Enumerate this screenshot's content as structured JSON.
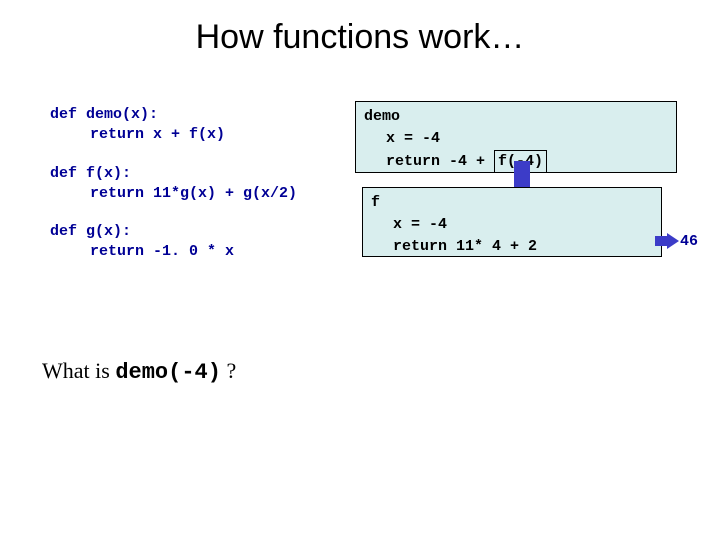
{
  "title": "How functions work…",
  "code": {
    "demo": {
      "def": "def demo(x):",
      "ret": "return x + f(x)"
    },
    "f": {
      "def": "def f(x):",
      "ret": "return 11*g(x) + g(x/2)"
    },
    "g": {
      "def": "def g(x):",
      "ret": "return -1. 0 * x"
    }
  },
  "trace": {
    "demo": {
      "name": "demo",
      "x": "x = -4",
      "ret_prefix": "return -4 + ",
      "ret_box": "f(-4)"
    },
    "f": {
      "name": "f",
      "x": "x = -4",
      "ret_prefix": "return",
      "ret_expr": " 11* 4  + 2"
    },
    "result": "46"
  },
  "question": {
    "prefix": "What is  ",
    "call": "demo(-4)",
    "suffix": "  ?"
  }
}
